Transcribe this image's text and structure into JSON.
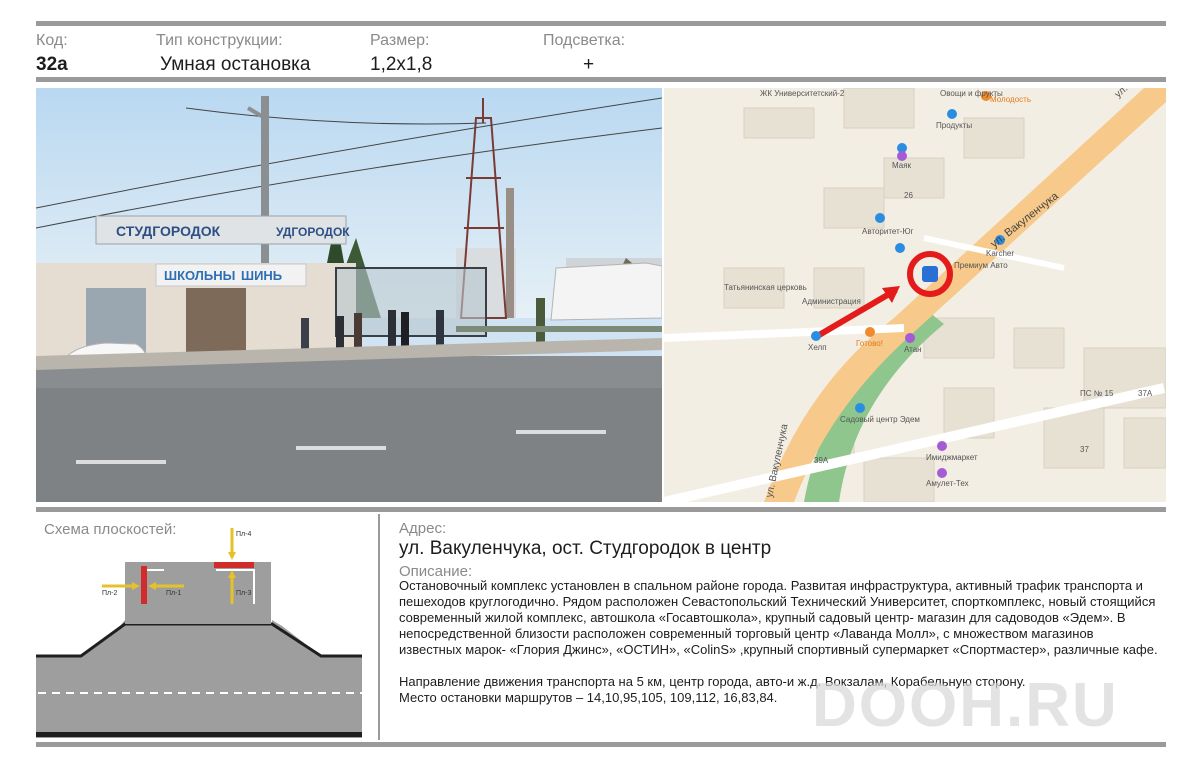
{
  "header": {
    "code_label": "Код:",
    "code_value": "32а",
    "type_label": "Тип конструкции:",
    "type_value": "Умная остановка",
    "size_label": "Размер:",
    "size_value": "1,2х1,8",
    "light_label": "Подсветка:",
    "light_value": "+"
  },
  "photo": {
    "sign_left": "СТУДГОРОДОК",
    "sign_right": "УДГОРОДОК",
    "shop_sign": "ШКОЛЬНЫ",
    "shop_sign2": "ШИНЬ"
  },
  "map": {
    "labels": [
      "ЖК Университетский-2",
      "ул. Вакуленчука",
      "Овощи и фрукты",
      "Молодость",
      "Продукты",
      "Маяк",
      "26",
      "Авторитет-Юг",
      "Karcher",
      "Премиум Авто",
      "Татьянинская церковь",
      "Администрация",
      "Хелп",
      "Готово!",
      "Атан",
      "Садовый центр Эдем",
      "Имиджмаркет",
      "39А",
      "Амулет-Тех",
      "ПС № 15",
      "37А",
      "37",
      "ул. Вакуленчука",
      "ул. Вакуленчука"
    ],
    "road_color": "#f7c98a",
    "marker_color": "#e41b1b"
  },
  "scheme": {
    "title": "Схема плоскостей:",
    "labels": {
      "p1": "Пл-1",
      "p2": "Пл-2",
      "p3": "Пл-3",
      "p4": "Пл-4"
    }
  },
  "address": {
    "label": "Адрес:",
    "value": "ул. Вакуленчука, ост. Студгородок в центр"
  },
  "description": {
    "label": "Описание:",
    "paragraph1": "Остановочный  комплекс установлен в спальном районе города. Развитая инфраструктура, активный трафик транспорта и пешеходов круглогодично. Рядом расположен  Севастопольский Технический Университет, спорткомплекс, новый стоящийся  современный жилой комплекс, автошкола «Госавтошкола»,  крупный садовый центр- магазин для садоводов «Эдем». В непосредственной близости расположен  современный торговый центр «Лаванда Молл», с множеством магазинов известных марок- «Глория Джинс», «ОСТИН», «ColinS» ,крупный спортивный супермаркет «Спортмастер», различные кафе.",
    "paragraph2": "Направление движения транспорта на 5 км, центр города, авто-и ж.д. Вокзалам, Корабельную сторону.",
    "paragraph3": "Место остановки маршрутов – 14,10,95,105, 109,112, 16,83,84."
  },
  "watermark": "DOOH.RU"
}
